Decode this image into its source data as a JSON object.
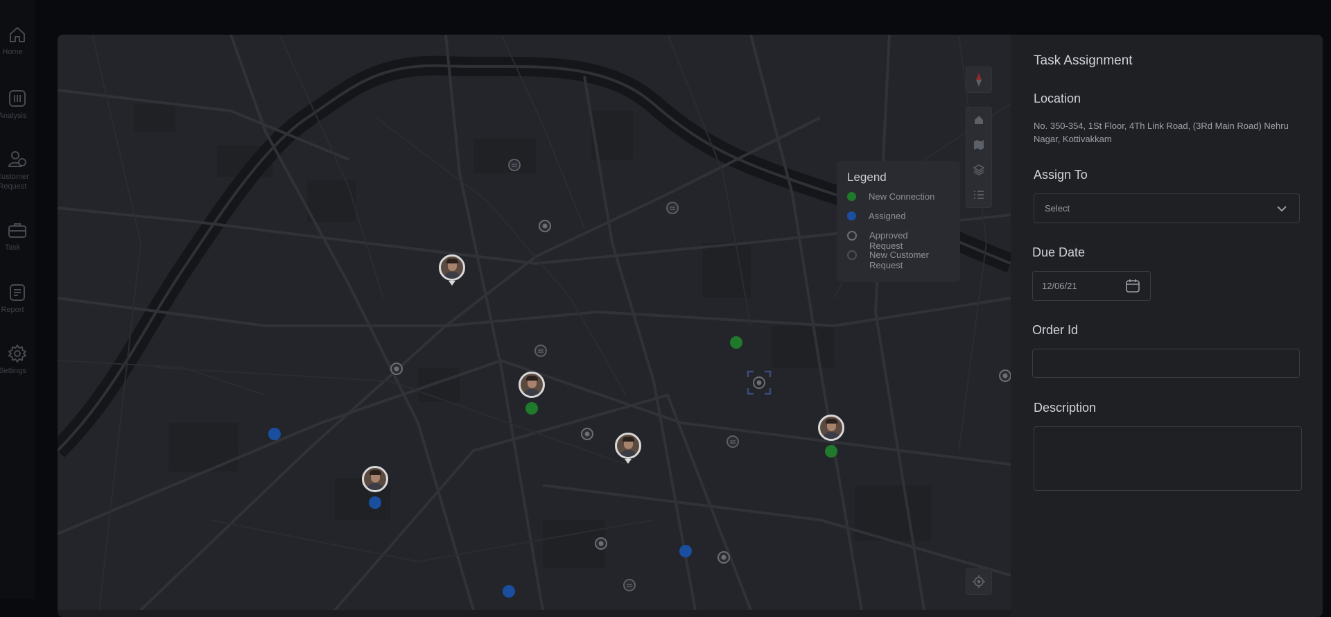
{
  "sidebar": {
    "items": [
      {
        "label": "Home",
        "icon": "home-icon"
      },
      {
        "label": "Analysis",
        "icon": "analysis-icon"
      },
      {
        "label": "Customer Request",
        "icon": "customer-request-icon"
      },
      {
        "label": "Task",
        "icon": "task-icon"
      },
      {
        "label": "Report",
        "icon": "report-icon"
      },
      {
        "label": "Settings",
        "icon": "settings-icon"
      }
    ]
  },
  "legend": {
    "title": "Legend",
    "items": [
      {
        "label": "New Connection",
        "color": "#1f7a2b"
      },
      {
        "label": "Assigned",
        "color": "#1a4fa0"
      },
      {
        "label": "Approved Request",
        "color": "#6b6e75"
      },
      {
        "label": "New Customer Request",
        "color": "#4b4e55"
      }
    ]
  },
  "map_controls": [
    "compass-icon",
    "home-icon",
    "map-icon",
    "layers-icon",
    "list-icon",
    "locate-icon"
  ],
  "panel": {
    "title": "Task Assignment",
    "location_label": "Location",
    "location_text": "No. 350-354, 1St Floor, 4Th Link Road,  (3Rd Main Road) Nehru Nagar, Kottivakkam",
    "assign_label": "Assign To",
    "assign_value": "Select",
    "due_label": "Due Date",
    "due_value": "12/06/21",
    "order_label": "Order Id",
    "order_value": "",
    "description_label": "Description",
    "description_value": ""
  },
  "colors": {
    "new_connection": "#1f7a2b",
    "assigned": "#1a4fa0",
    "accent_compass": "#8a2a2a"
  }
}
